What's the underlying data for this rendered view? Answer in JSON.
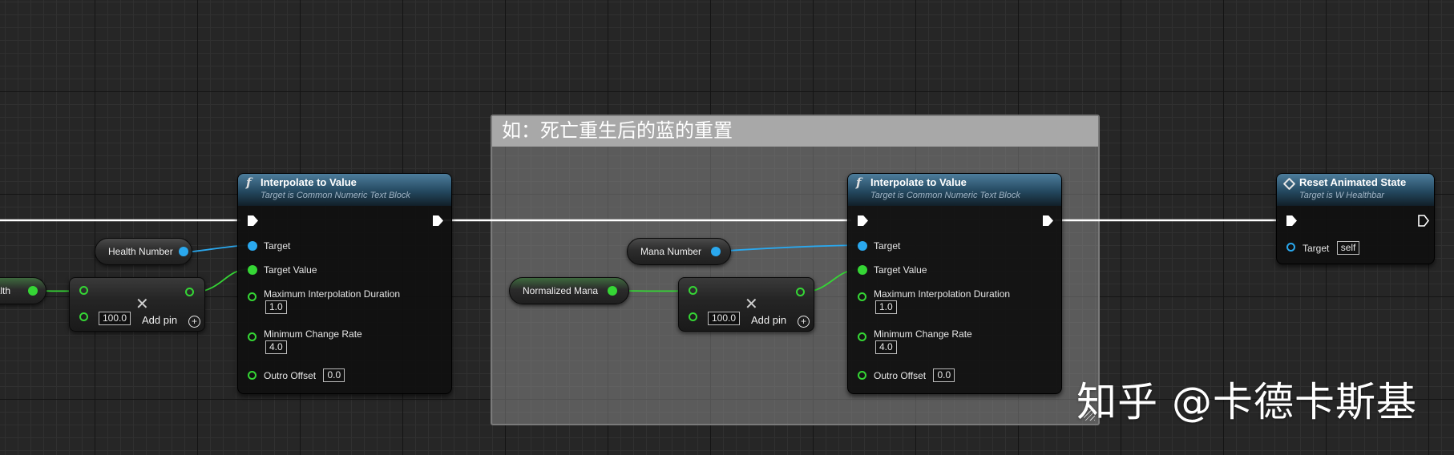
{
  "comment": {
    "title": "如：死亡重生后的蓝的重置"
  },
  "left_var_partial": {
    "label": "ealth"
  },
  "health_var": {
    "label": "Health Number"
  },
  "mana_var": {
    "label": "Mana Number"
  },
  "normalized_mana_var": {
    "label": "Normalized Mana"
  },
  "multiply_1": {
    "value": "100.0",
    "add_pin": "Add pin"
  },
  "multiply_2": {
    "value": "100.0",
    "add_pin": "Add pin"
  },
  "interp_1": {
    "title": "Interpolate to Value",
    "subtitle": "Target is Common Numeric Text Block",
    "target": "Target",
    "target_value": "Target Value",
    "max_duration_label": "Maximum Interpolation Duration",
    "max_duration": "1.0",
    "min_rate_label": "Minimum Change Rate",
    "min_rate": "4.0",
    "outro_label": "Outro Offset",
    "outro": "0.0"
  },
  "interp_2": {
    "title": "Interpolate to Value",
    "subtitle": "Target is Common Numeric Text Block",
    "target": "Target",
    "target_value": "Target Value",
    "max_duration_label": "Maximum Interpolation Duration",
    "max_duration": "1.0",
    "min_rate_label": "Minimum Change Rate",
    "min_rate": "4.0",
    "outro_label": "Outro Offset",
    "outro": "0.0"
  },
  "reset_node": {
    "title": "Reset Animated State",
    "subtitle": "Target is W Healthbar",
    "target": "Target",
    "target_value": "self"
  },
  "watermark": "知乎 @卡德卡斯基",
  "colors": {
    "exec": "#ffffff",
    "object_pin": "#2aa8ee",
    "float_pin": "#35d635",
    "node_header": "#24485f"
  }
}
